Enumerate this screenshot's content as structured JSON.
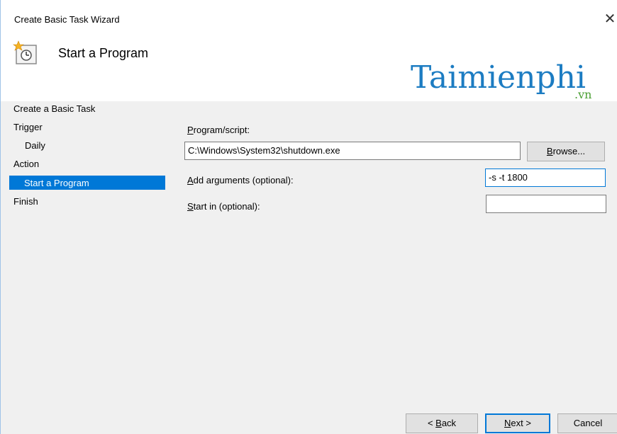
{
  "window": {
    "title": "Create Basic Task Wizard"
  },
  "header": {
    "page_title": "Start a Program",
    "icon": "scheduled-task-icon"
  },
  "watermark": {
    "logo_main": "Taimienphi",
    "logo_sub": ".vn"
  },
  "nav": {
    "items": [
      {
        "label": "Create a Basic Task"
      },
      {
        "label": "Trigger"
      },
      {
        "label": "Daily"
      },
      {
        "label": "Action"
      },
      {
        "label": "Start a Program",
        "selected": true
      },
      {
        "label": "Finish"
      }
    ]
  },
  "form": {
    "program_label_key": "P",
    "program_label_rest": "rogram/script:",
    "program_value": "C:\\Windows\\System32\\shutdown.exe",
    "browse_label_key": "B",
    "browse_label_pre": "",
    "browse_label_rest": "rowse...",
    "args_label_key": "A",
    "args_label_rest": "dd arguments (optional):",
    "args_value": "-s -t 1800",
    "startin_label_key": "S",
    "startin_label_rest": "tart in (optional):",
    "startin_value": ""
  },
  "buttons": {
    "back_pre": "< ",
    "back_key": "B",
    "back_rest": "ack",
    "next_key": "N",
    "next_rest": "ext >",
    "cancel": "Cancel"
  },
  "colors": {
    "selection": "#0078d7",
    "logo": "#1c7cc2",
    "logo_sub": "#4a9f33"
  }
}
